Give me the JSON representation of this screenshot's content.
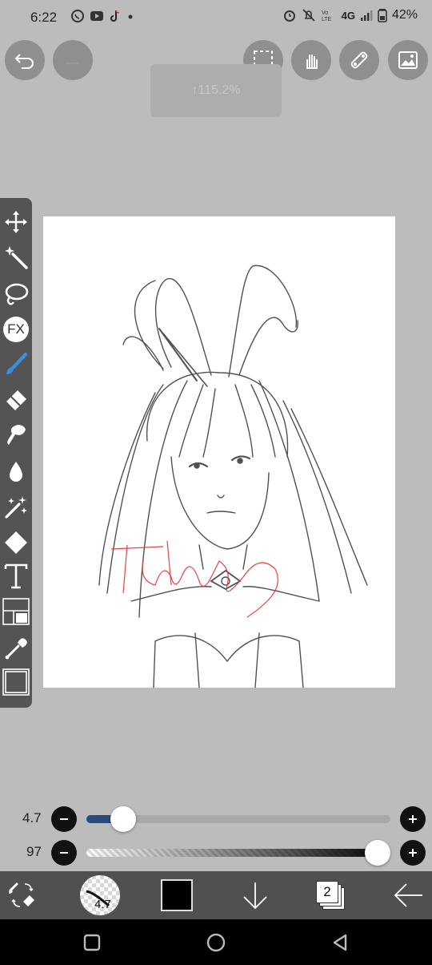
{
  "status_bar": {
    "time": "6:22",
    "battery": "42%",
    "network": "4G",
    "notification_icons": [
      "whatsapp-icon",
      "youtube-icon",
      "tiktok-icon",
      "dot-icon"
    ],
    "system_icons": [
      "alarm-icon",
      "mute-icon",
      "volte-icon",
      "signal-icon",
      "battery-icon"
    ]
  },
  "top_controls": {
    "zoom_label": "↑115.2%"
  },
  "left_tools": [
    "move-tool",
    "magic-wand-tool",
    "lasso-tool",
    "fx-tool",
    "brush-tool",
    "eraser-tool",
    "smudge-tool",
    "blur-tool",
    "sparkle-tool",
    "fill-tool",
    "text-tool",
    "frame-divider-tool",
    "eyedropper-tool",
    "canvas-tool"
  ],
  "fx_label": "FX",
  "sliders": {
    "brush_size": {
      "value_label": "4.7",
      "level": 0.08
    },
    "opacity": {
      "value_label": "97",
      "level": 0.97
    }
  },
  "bottom_bar": {
    "brush_size_label": "4.7",
    "layer_count": "2",
    "color": "#000000"
  },
  "colors": {
    "background": "#bcbcbc",
    "toolbar": "#545454",
    "accent": "#2a4a7a",
    "brush_active": "#3a8de0"
  }
}
